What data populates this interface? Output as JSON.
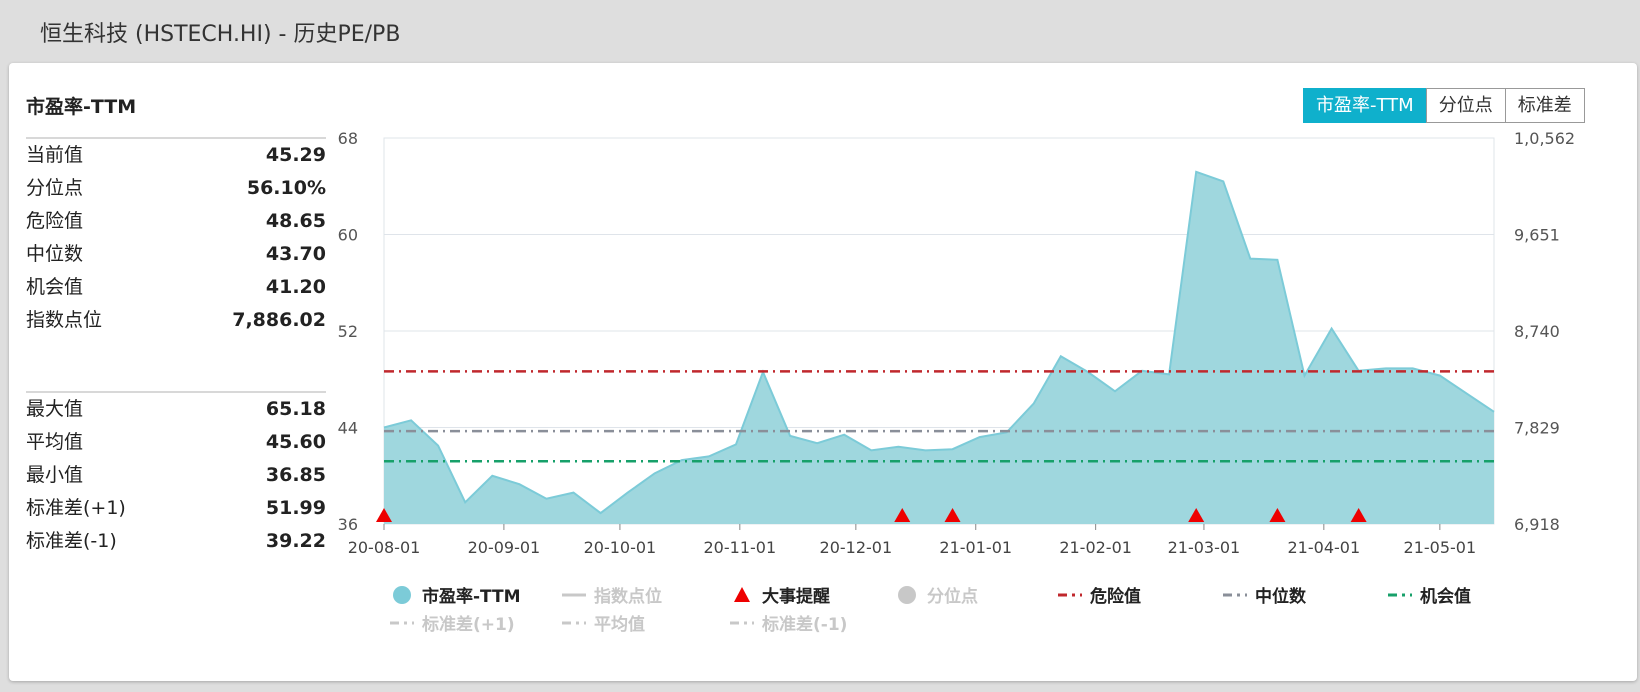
{
  "page": {
    "title": "恒生科技 (HSTECH.HI) - 历史PE/PB"
  },
  "panel": {
    "title": "市盈率-TTM",
    "stats_primary": [
      {
        "label": "当前值",
        "value": "45.29"
      },
      {
        "label": "分位点",
        "value": "56.10%"
      },
      {
        "label": "危险值",
        "value": "48.65"
      },
      {
        "label": "中位数",
        "value": "43.70"
      },
      {
        "label": "机会值",
        "value": "41.20"
      },
      {
        "label": "指数点位",
        "value": "7,886.02"
      }
    ],
    "stats_secondary": [
      {
        "label": "最大值",
        "value": "65.18"
      },
      {
        "label": "平均值",
        "value": "45.60"
      },
      {
        "label": "最小值",
        "value": "36.85"
      },
      {
        "label": "标准差(+1)",
        "value": "51.99"
      },
      {
        "label": "标准差(-1)",
        "value": "39.22"
      }
    ]
  },
  "tabs": [
    {
      "label": "市盈率-TTM",
      "active": true
    },
    {
      "label": "分位点",
      "active": false
    },
    {
      "label": "标准差",
      "active": false
    }
  ],
  "legend": [
    {
      "label": "市盈率-TTM",
      "symbol": "circle",
      "color": "#7ccbd8",
      "enabled": true
    },
    {
      "label": "指数点位",
      "symbol": "line",
      "color": "#c8c8c8",
      "enabled": false
    },
    {
      "label": "大事提醒",
      "symbol": "triangle",
      "color": "#ee0000",
      "enabled": true
    },
    {
      "label": "分位点",
      "symbol": "circle",
      "color": "#c8c8c8",
      "enabled": false
    },
    {
      "label": "危险值",
      "symbol": "dash",
      "color": "#c0282d",
      "enabled": true
    },
    {
      "label": "中位数",
      "symbol": "dash",
      "color": "#8a8f99",
      "enabled": true
    },
    {
      "label": "机会值",
      "symbol": "dash",
      "color": "#17a06a",
      "enabled": true
    },
    {
      "label": "标准差(+1)",
      "symbol": "dash",
      "color": "#c8c8c8",
      "enabled": false
    },
    {
      "label": "平均值",
      "symbol": "dash",
      "color": "#c8c8c8",
      "enabled": false
    },
    {
      "label": "标准差(-1)",
      "symbol": "dash",
      "color": "#c8c8c8",
      "enabled": false
    }
  ],
  "chart_data": {
    "type": "area",
    "colors": {
      "area_fill": "#9fd7de",
      "area_line": "#7ccbd8",
      "grid": "#dfe4ea",
      "event_marker": "#ee0000"
    },
    "x_ticks": [
      "20-08-01",
      "20-09-01",
      "20-10-01",
      "20-11-01",
      "20-12-01",
      "21-01-01",
      "21-02-01",
      "21-03-01",
      "21-04-01",
      "21-05-01"
    ],
    "x_tick_dates": [
      "2020-08-01",
      "2020-09-01",
      "2020-10-01",
      "2020-11-01",
      "2020-12-01",
      "2021-01-01",
      "2021-02-01",
      "2021-03-01",
      "2021-04-01",
      "2021-05-01"
    ],
    "x_range": [
      "2020-08-01",
      "2021-05-15"
    ],
    "y_left": {
      "range": [
        36,
        68
      ],
      "ticks": [
        "36",
        "44",
        "52",
        "60",
        "68"
      ]
    },
    "y_right": {
      "range": [
        6918,
        10562
      ],
      "ticks": [
        "6,918",
        "7,829",
        "8,740",
        "9,651",
        "1,0,562"
      ]
    },
    "series": [
      {
        "name": "市盈率-TTM",
        "points": [
          [
            "2020-08-01",
            44.0
          ],
          [
            "2020-08-08",
            44.6
          ],
          [
            "2020-08-15",
            42.5
          ],
          [
            "2020-08-22",
            37.8
          ],
          [
            "2020-08-29",
            40.0
          ],
          [
            "2020-09-05",
            39.3
          ],
          [
            "2020-09-12",
            38.1
          ],
          [
            "2020-09-19",
            38.6
          ],
          [
            "2020-09-26",
            36.9
          ],
          [
            "2020-10-03",
            38.6
          ],
          [
            "2020-10-10",
            40.2
          ],
          [
            "2020-10-17",
            41.3
          ],
          [
            "2020-10-24",
            41.6
          ],
          [
            "2020-10-31",
            42.6
          ],
          [
            "2020-11-07",
            48.6
          ],
          [
            "2020-11-14",
            43.3
          ],
          [
            "2020-11-21",
            42.7
          ],
          [
            "2020-11-28",
            43.4
          ],
          [
            "2020-12-05",
            42.1
          ],
          [
            "2020-12-12",
            42.4
          ],
          [
            "2020-12-19",
            42.1
          ],
          [
            "2020-12-26",
            42.2
          ],
          [
            "2021-01-02",
            43.2
          ],
          [
            "2021-01-09",
            43.6
          ],
          [
            "2021-01-16",
            46.0
          ],
          [
            "2021-01-23",
            49.9
          ],
          [
            "2021-01-30",
            48.6
          ],
          [
            "2021-02-06",
            47.0
          ],
          [
            "2021-02-13",
            48.7
          ],
          [
            "2021-02-20",
            48.4
          ],
          [
            "2021-02-27",
            65.2
          ],
          [
            "2021-03-06",
            64.4
          ],
          [
            "2021-03-13",
            58.0
          ],
          [
            "2021-03-20",
            57.9
          ],
          [
            "2021-03-27",
            48.3
          ],
          [
            "2021-04-03",
            52.2
          ],
          [
            "2021-04-10",
            48.7
          ],
          [
            "2021-04-17",
            48.9
          ],
          [
            "2021-04-24",
            48.9
          ],
          [
            "2021-05-01",
            48.3
          ],
          [
            "2021-05-08",
            46.8
          ],
          [
            "2021-05-15",
            45.3
          ]
        ]
      }
    ],
    "reference_lines": [
      {
        "name": "危险值",
        "value": 48.65,
        "color": "#c0282d"
      },
      {
        "name": "中位数",
        "value": 43.7,
        "color": "#8a8f99"
      },
      {
        "name": "机会值",
        "value": 41.2,
        "color": "#17a06a"
      }
    ],
    "event_markers": [
      "2020-08-01",
      "2020-12-13",
      "2020-12-26",
      "2021-02-27",
      "2021-03-20",
      "2021-04-10"
    ]
  }
}
